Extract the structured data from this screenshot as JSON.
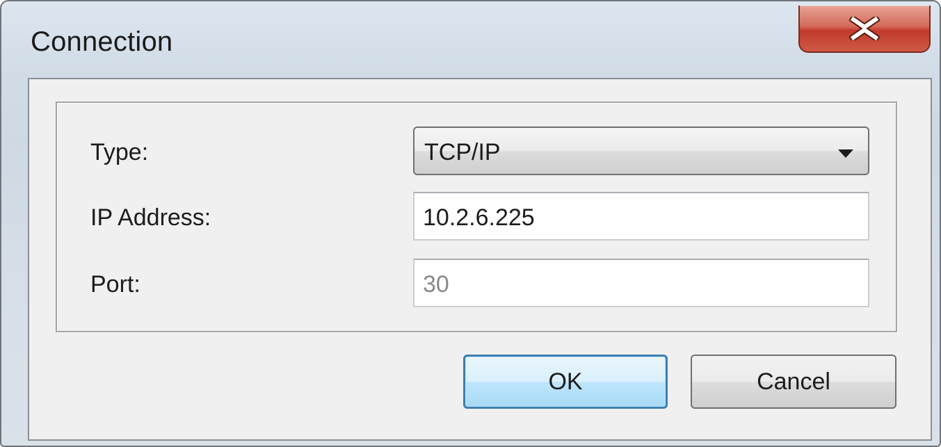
{
  "window": {
    "title": "Connection",
    "close_icon": "close-x-icon"
  },
  "form": {
    "type_label": "Type:",
    "type_value": "TCP/IP",
    "type_arrow_icon": "dropdown-arrow-icon",
    "ip_label": "IP Address:",
    "ip_value": "10.2.6.225",
    "port_label": "Port:",
    "port_value": "30"
  },
  "buttons": {
    "ok_label": "OK",
    "cancel_label": "Cancel"
  },
  "colors": {
    "close_button": "#c0392b",
    "default_button_border": "#3c7fb1",
    "disabled_text": "#8a8a8a"
  }
}
